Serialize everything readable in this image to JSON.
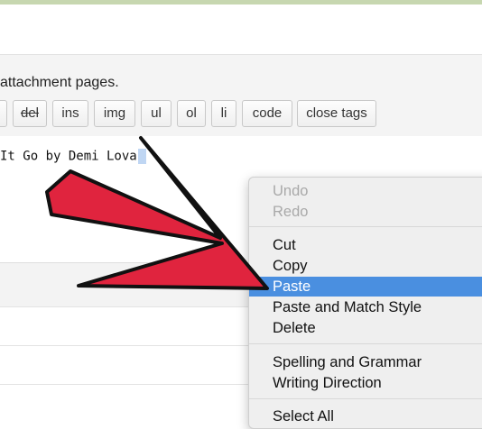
{
  "settings": {
    "description": "attachment pages."
  },
  "quicktags": [
    "del",
    "ins",
    "img",
    "ul",
    "ol",
    "li",
    "code",
    "close tags"
  ],
  "editor": {
    "text": "It Go by Demi Lova"
  },
  "context_menu": {
    "undo": "Undo",
    "redo": "Redo",
    "cut": "Cut",
    "copy": "Copy",
    "paste": "Paste",
    "paste_match": "Paste and Match Style",
    "delete": "Delete",
    "spelling": "Spelling and Grammar",
    "writing_direction": "Writing Direction",
    "select_all": "Select All"
  },
  "colors": {
    "arrow": "#e0243e",
    "highlight": "#4a8fe0",
    "topbar": "#c7d7b0"
  }
}
